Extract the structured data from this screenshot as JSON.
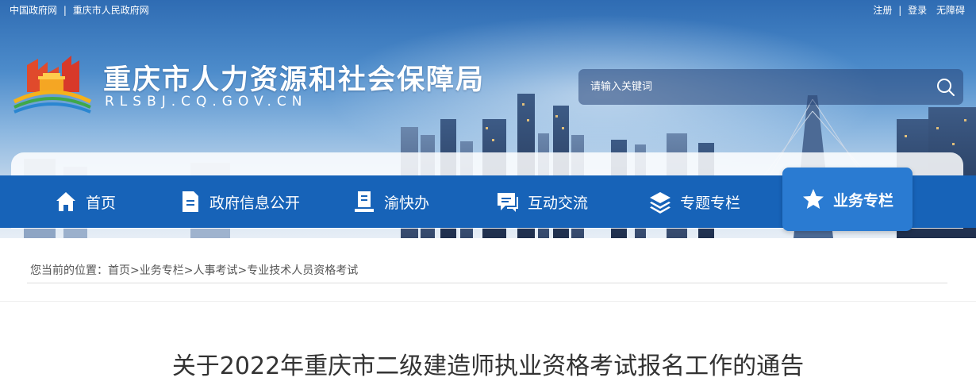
{
  "topbar": {
    "links_left": [
      "中国政府网",
      "重庆市人民政府网"
    ],
    "separator": "|",
    "links_right": [
      "注册",
      "登录",
      "无障碍"
    ]
  },
  "site": {
    "title": "重庆市人力资源和社会保障局",
    "domain": "RLSBJ.CQ.GOV.CN"
  },
  "search": {
    "placeholder": "请输入关键词",
    "icon": "search-icon"
  },
  "nav": {
    "items": [
      {
        "label": "首页",
        "icon": "home-icon"
      },
      {
        "label": "政府信息公开",
        "icon": "document-icon"
      },
      {
        "label": "渝快办",
        "icon": "service-icon"
      },
      {
        "label": "互动交流",
        "icon": "chat-icon"
      },
      {
        "label": "专题专栏",
        "icon": "layers-icon"
      },
      {
        "label": "业务专栏",
        "icon": "star-icon",
        "active": true
      }
    ]
  },
  "breadcrumb": {
    "prefix": "您当前的位置：",
    "items": [
      "首页",
      "业务专栏",
      "人事考试",
      "专业技术人员资格考试"
    ],
    "separator": ">"
  },
  "article": {
    "title": "关于2022年重庆市二级建造师执业资格考试报名工作的通告"
  },
  "colors": {
    "nav_bg": "#1763b8",
    "nav_active_bg": "#2a7bd2",
    "title_text": "#333333"
  }
}
